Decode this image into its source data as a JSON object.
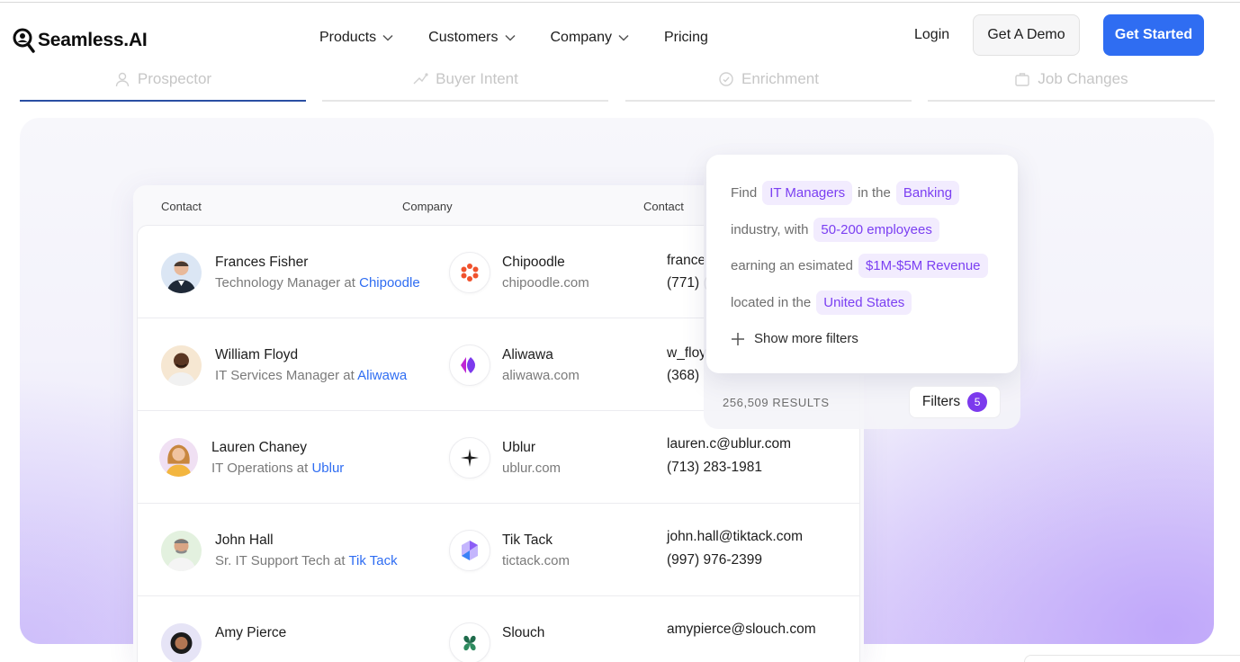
{
  "brand": {
    "name": "Seamless.AI",
    "accent": "#2f6df2",
    "purple": "#7b3ff2"
  },
  "nav": {
    "items": [
      {
        "label": "Products",
        "dropdown": true
      },
      {
        "label": "Customers",
        "dropdown": true
      },
      {
        "label": "Company",
        "dropdown": true
      },
      {
        "label": "Pricing",
        "dropdown": false
      }
    ],
    "login": "Login",
    "demo": "Get A Demo",
    "start": "Get Started"
  },
  "tabs": [
    {
      "label": "Prospector",
      "icon": "person-icon",
      "active": true
    },
    {
      "label": "Buyer Intent",
      "icon": "intent-icon",
      "active": false
    },
    {
      "label": "Enrichment",
      "icon": "enrichment-icon",
      "active": false
    },
    {
      "label": "Job Changes",
      "icon": "briefcase-icon",
      "active": false
    }
  ],
  "table": {
    "columns": [
      "Contact",
      "Company",
      "Contact"
    ],
    "rows": [
      {
        "name": "Frances Fisher",
        "role": "Technology Manager at",
        "company": "Chipoodle",
        "domain": "chipoodle.com",
        "email": "france",
        "phone": "(771) ("
      },
      {
        "name": "William Floyd",
        "role": "IT Services Manager at",
        "company": "Aliwawa",
        "domain": "aliwawa.com",
        "email": "w_floy",
        "phone": "(368)"
      },
      {
        "name": "Lauren Chaney",
        "role": "IT Operations at",
        "company": "Ublur",
        "domain": "ublur.com",
        "email": "lauren.c@ublur.com",
        "phone": "(713) 283-1981"
      },
      {
        "name": "John Hall",
        "role": "Sr. IT Support Tech at",
        "company": "Tik Tack",
        "domain": "tictack.com",
        "email": "john.hall@tiktack.com",
        "phone": "(997) 976-2399"
      },
      {
        "name": "Amy Pierce",
        "role": "",
        "company": "Slouch",
        "domain": "",
        "email": "amypierce@slouch.com",
        "phone": ""
      }
    ]
  },
  "filter": {
    "find": "Find",
    "title_chip": "IT Managers",
    "in_the": "in the",
    "industry_chip": "Banking",
    "industry_with": "industry, with",
    "employees_chip": "50-200 employees",
    "earning": "earning an esimated",
    "revenue_chip": "$1M-$5M Revenue",
    "located": "located in the",
    "location_chip": "United States",
    "more": "Show more filters",
    "results": "256,509 RESULTS",
    "filters_label": "Filters",
    "filters_count": "5"
  }
}
